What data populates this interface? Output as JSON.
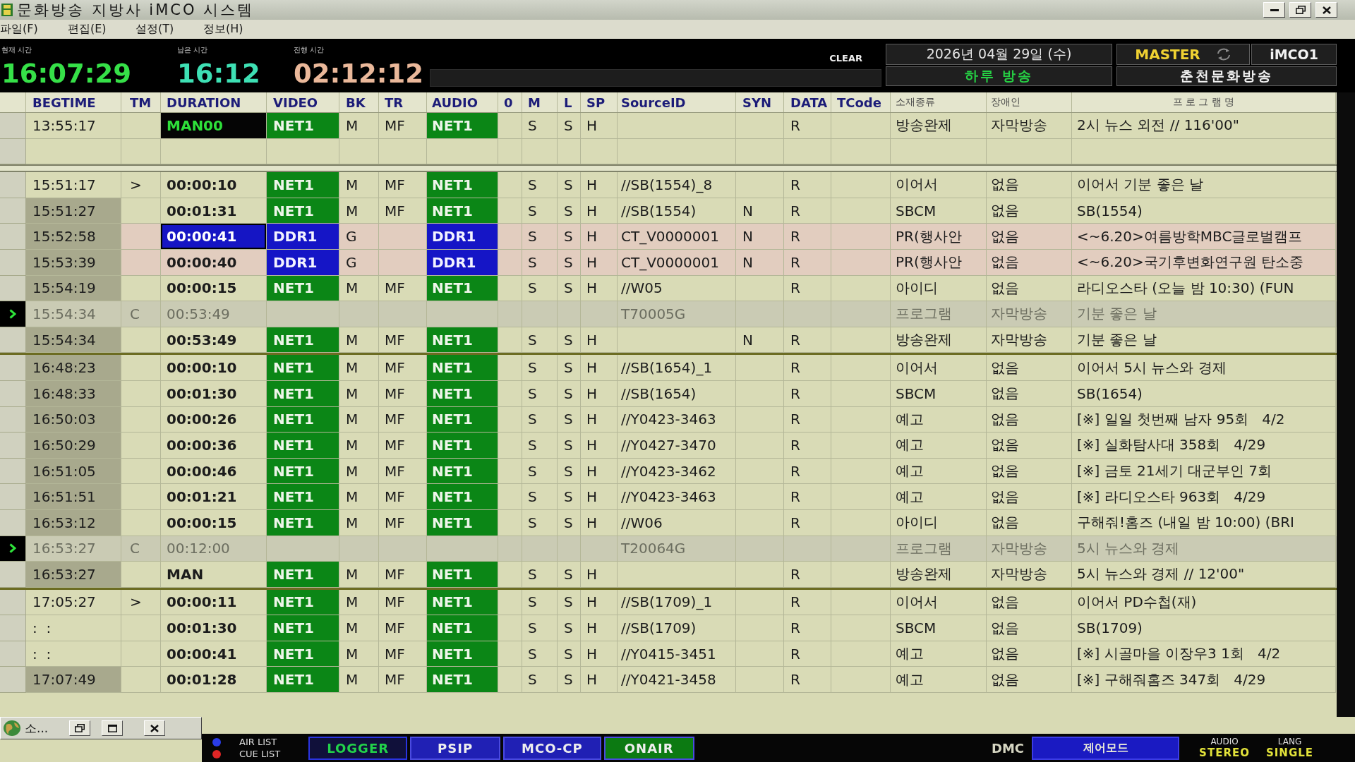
{
  "window": {
    "title": "문화방송 지방사 iMCO 시스템"
  },
  "menu": [
    "파일(F)",
    "편집(E)",
    "설정(T)",
    "정보(H)"
  ],
  "header": {
    "clocks": [
      {
        "label": "현재 시간",
        "time": "16:07:29",
        "color": "#36e048"
      },
      {
        "label": "남은 시간",
        "time": "16:12",
        "color": "#3ee0b4"
      },
      {
        "label": "진행 시간",
        "time": "02:12:12",
        "color": "#eab89a"
      }
    ],
    "clear": "CLEAR",
    "date": "2026년 04월 29일 (수)",
    "mode": "하루 방송",
    "master": "MASTER",
    "system": "iMCO1",
    "station": "춘천문화방송"
  },
  "table": {
    "columns": [
      "BEGTIME",
      "TM",
      "DURATION",
      "VIDEO",
      "BK",
      "TR",
      "AUDIO",
      "0",
      "M",
      "L",
      "SP",
      "SourceID",
      "SYN",
      "DATA",
      "TCode",
      "소재종류",
      "장애인",
      "프 로 그 램 명"
    ],
    "pinned_row": {
      "kind": "net",
      "on_air": true,
      "begtime": "13:55:17",
      "duration": "MAN00",
      "video": "NET1",
      "bk": "M",
      "tr": "MF",
      "audio": "NET1",
      "m": "S",
      "l": "S",
      "sp": "H",
      "data": "R",
      "material": "방송완제",
      "accessibility": "자막방송",
      "program": "2시 뉴스 외전 // 116'00\""
    },
    "blocks": [
      {
        "rows": [
          {
            "kind": "net",
            "selected": false,
            "begtime_shaded": false,
            "begtime": "15:51:17",
            "tm": ">",
            "duration": "00:00:10",
            "video": "NET1",
            "bk": "M",
            "tr": "MF",
            "audio": "NET1",
            "m": "S",
            "l": "S",
            "sp": "H",
            "source_id": "//SB(1554)_8",
            "data": "R",
            "material": "이어서",
            "accessibility": "없음",
            "program": "이어서 기분 좋은 날"
          },
          {
            "kind": "net",
            "selected": false,
            "begtime_shaded": true,
            "begtime": "15:51:27",
            "duration": "00:01:31",
            "video": "NET1",
            "bk": "M",
            "tr": "MF",
            "audio": "NET1",
            "m": "S",
            "l": "S",
            "sp": "H",
            "source_id": "//SB(1554)",
            "sync": "N",
            "data": "R",
            "material": "SBCM",
            "accessibility": "없음",
            "program": "SB(1554)"
          },
          {
            "kind": "ddr",
            "selected": true,
            "begtime_shaded": true,
            "begtime": "15:52:58",
            "duration": "00:00:41",
            "video": "DDR1",
            "bk": "G",
            "audio": "DDR1",
            "m": "S",
            "l": "S",
            "sp": "H",
            "source_id": "CT_V0000001",
            "sync": "N",
            "data": "R",
            "material": "PR(행사안",
            "accessibility": "없음",
            "program": "<~6.20>여름방학MBC글로벌캠프"
          },
          {
            "kind": "ddr",
            "selected": false,
            "begtime_shaded": true,
            "begtime": "15:53:39",
            "duration": "00:00:40",
            "video": "DDR1",
            "bk": "G",
            "audio": "DDR1",
            "m": "S",
            "l": "S",
            "sp": "H",
            "source_id": "CT_V0000001",
            "sync": "N",
            "data": "R",
            "material": "PR(행사안",
            "accessibility": "없음",
            "program": "<~6.20>국기후변화연구원 탄소중"
          },
          {
            "kind": "net",
            "selected": false,
            "begtime_shaded": true,
            "begtime": "15:54:19",
            "duration": "00:00:15",
            "video": "NET1",
            "bk": "M",
            "tr": "MF",
            "audio": "NET1",
            "m": "S",
            "l": "S",
            "sp": "H",
            "source_id": "//W05",
            "data": "R",
            "material": "아이디",
            "accessibility": "없음",
            "program": "라디오스타 (오늘 밤 10:30) (FUN"
          },
          {
            "kind": "program",
            "selected": false,
            "begtime_shaded": false,
            "begtime": "15:54:34",
            "tm": "C",
            "duration": "00:53:49",
            "source_id": "T70005G",
            "material": "프로그램",
            "accessibility": "자막방송",
            "program": "기분 좋은 날"
          },
          {
            "kind": "net",
            "selected": false,
            "begtime_shaded": true,
            "begtime": "15:54:34",
            "duration": "00:53:49",
            "video": "NET1",
            "bk": "M",
            "tr": "MF",
            "audio": "NET1",
            "m": "S",
            "l": "S",
            "sp": "H",
            "sync": "N",
            "data": "R",
            "material": "방송완제",
            "accessibility": "자막방송",
            "program": "기분 좋은 날"
          }
        ]
      },
      {
        "rows": [
          {
            "kind": "net",
            "selected": false,
            "begtime_shaded": true,
            "begtime": "16:48:23",
            "duration": "00:00:10",
            "video": "NET1",
            "bk": "M",
            "tr": "MF",
            "audio": "NET1",
            "m": "S",
            "l": "S",
            "sp": "H",
            "source_id": "//SB(1654)_1",
            "data": "R",
            "material": "이어서",
            "accessibility": "없음",
            "program": "이어서 5시 뉴스와 경제"
          },
          {
            "kind": "net",
            "selected": false,
            "begtime_shaded": true,
            "begtime": "16:48:33",
            "duration": "00:01:30",
            "video": "NET1",
            "bk": "M",
            "tr": "MF",
            "audio": "NET1",
            "m": "S",
            "l": "S",
            "sp": "H",
            "source_id": "//SB(1654)",
            "data": "R",
            "material": "SBCM",
            "accessibility": "없음",
            "program": "SB(1654)"
          },
          {
            "kind": "net",
            "selected": false,
            "begtime_shaded": true,
            "begtime": "16:50:03",
            "duration": "00:00:26",
            "video": "NET1",
            "bk": "M",
            "tr": "MF",
            "audio": "NET1",
            "m": "S",
            "l": "S",
            "sp": "H",
            "source_id": "//Y0423-3463",
            "data": "R",
            "material": "예고",
            "accessibility": "없음",
            "program": "[※] 일일 첫번째 남자 95회   4/2"
          },
          {
            "kind": "net",
            "selected": false,
            "begtime_shaded": true,
            "begtime": "16:50:29",
            "duration": "00:00:36",
            "video": "NET1",
            "bk": "M",
            "tr": "MF",
            "audio": "NET1",
            "m": "S",
            "l": "S",
            "sp": "H",
            "source_id": "//Y0427-3470",
            "data": "R",
            "material": "예고",
            "accessibility": "없음",
            "program": "[※] 실화탐사대 358회   4/29"
          },
          {
            "kind": "net",
            "selected": false,
            "begtime_shaded": true,
            "begtime": "16:51:05",
            "duration": "00:00:46",
            "video": "NET1",
            "bk": "M",
            "tr": "MF",
            "audio": "NET1",
            "m": "S",
            "l": "S",
            "sp": "H",
            "source_id": "//Y0423-3462",
            "data": "R",
            "material": "예고",
            "accessibility": "없음",
            "program": "[※] 금토 21세기 대군부인 7회"
          },
          {
            "kind": "net",
            "selected": false,
            "begtime_shaded": true,
            "begtime": "16:51:51",
            "duration": "00:01:21",
            "video": "NET1",
            "bk": "M",
            "tr": "MF",
            "audio": "NET1",
            "m": "S",
            "l": "S",
            "sp": "H",
            "source_id": "//Y0423-3463",
            "data": "R",
            "material": "예고",
            "accessibility": "없음",
            "program": "[※] 라디오스타 963회   4/29"
          },
          {
            "kind": "net",
            "selected": false,
            "begtime_shaded": true,
            "begtime": "16:53:12",
            "duration": "00:00:15",
            "video": "NET1",
            "bk": "M",
            "tr": "MF",
            "audio": "NET1",
            "m": "S",
            "l": "S",
            "sp": "H",
            "source_id": "//W06",
            "data": "R",
            "material": "아이디",
            "accessibility": "없음",
            "program": "구해줘!홈즈 (내일 밤 10:00) (BRI"
          },
          {
            "kind": "program",
            "selected": false,
            "begtime_shaded": false,
            "begtime": "16:53:27",
            "tm": "C",
            "duration": "00:12:00",
            "source_id": "T20064G",
            "material": "프로그램",
            "accessibility": "자막방송",
            "program": "5시 뉴스와 경제"
          },
          {
            "kind": "net",
            "selected": false,
            "begtime_shaded": true,
            "begtime": "16:53:27",
            "duration": "MAN",
            "video": "NET1",
            "bk": "M",
            "tr": "MF",
            "audio": "NET1",
            "m": "S",
            "l": "S",
            "sp": "H",
            "data": "R",
            "material": "방송완제",
            "accessibility": "자막방송",
            "program": "5시 뉴스와 경제 // 12'00\""
          }
        ]
      },
      {
        "rows": [
          {
            "kind": "net",
            "selected": false,
            "begtime_shaded": false,
            "begtime": "17:05:27",
            "tm": ">",
            "duration": "00:00:11",
            "video": "NET1",
            "bk": "M",
            "tr": "MF",
            "audio": "NET1",
            "m": "S",
            "l": "S",
            "sp": "H",
            "source_id": "//SB(1709)_1",
            "data": "R",
            "material": "이어서",
            "accessibility": "없음",
            "program": "이어서 PD수첩(재)"
          },
          {
            "kind": "net",
            "selected": false,
            "begtime_shaded": false,
            "begtime": ":  :",
            "duration": "00:01:30",
            "video": "NET1",
            "bk": "M",
            "tr": "MF",
            "audio": "NET1",
            "m": "S",
            "l": "S",
            "sp": "H",
            "source_id": "//SB(1709)",
            "data": "R",
            "material": "SBCM",
            "accessibility": "없음",
            "program": "SB(1709)"
          },
          {
            "kind": "net",
            "selected": false,
            "begtime_shaded": false,
            "begtime": ":  :",
            "duration": "00:00:41",
            "video": "NET1",
            "bk": "M",
            "tr": "MF",
            "audio": "NET1",
            "m": "S",
            "l": "S",
            "sp": "H",
            "source_id": "//Y0415-3451",
            "data": "R",
            "material": "예고",
            "accessibility": "없음",
            "program": "[※] 시골마을 이장우3 1회   4/2"
          },
          {
            "kind": "net",
            "selected": false,
            "begtime_shaded": true,
            "begtime": "17:07:49",
            "duration": "00:01:28",
            "video": "NET1",
            "bk": "M",
            "tr": "MF",
            "audio": "NET1",
            "m": "S",
            "l": "S",
            "sp": "H",
            "source_id": "//Y0421-3458",
            "data": "R",
            "material": "예고",
            "accessibility": "없음",
            "program": "[※] 구해줘홈즈 347회   4/29"
          }
        ]
      }
    ]
  },
  "minimized_window": {
    "title": "소..."
  },
  "status_bar": {
    "lists": [
      {
        "label": "AIR LIST",
        "color": "#2a3ce8"
      },
      {
        "label": "CUE LIST",
        "color": "#e02626"
      }
    ],
    "buttons": [
      {
        "label": "LOGGER",
        "selected": true,
        "color": "#10103a"
      },
      {
        "label": "PSIP",
        "selected": false,
        "color": "#2020b4"
      },
      {
        "label": "MCO-CP",
        "selected": false,
        "color": "#2020b4"
      },
      {
        "label": "ONAIR",
        "selected": false,
        "color": "#0c7a12"
      }
    ],
    "dmc": "DMC",
    "mode_button": "제어모드",
    "indicators": [
      {
        "label": "AUDIO",
        "value": "STEREO"
      },
      {
        "label": "LANG",
        "value": "SINGLE"
      }
    ]
  }
}
